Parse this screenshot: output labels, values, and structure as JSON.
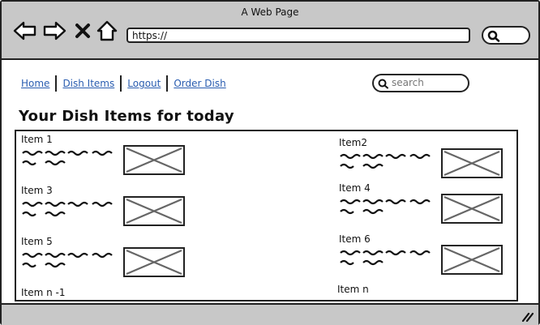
{
  "window": {
    "title": "A Web Page"
  },
  "browser": {
    "url": "https://",
    "icons": [
      "back-arrow-icon",
      "forward-arrow-icon",
      "close-x-icon",
      "home-icon",
      "search-icon"
    ]
  },
  "nav": {
    "links": [
      "Home",
      "Dish Items",
      "Logout",
      "Order Dish"
    ],
    "search_placeholder": "search"
  },
  "page": {
    "heading": "Your Dish Items for today"
  },
  "items": [
    {
      "name": "Item 1"
    },
    {
      "name": "Item2"
    },
    {
      "name": "Item 3"
    },
    {
      "name": "Item 4"
    },
    {
      "name": "Item 5"
    },
    {
      "name": "Item 6"
    },
    {
      "name": "Item n -1"
    },
    {
      "name": "Item n"
    }
  ],
  "colors": {
    "chrome": "#c8c8c8",
    "link": "#2a5db0",
    "stroke": "#222222"
  }
}
